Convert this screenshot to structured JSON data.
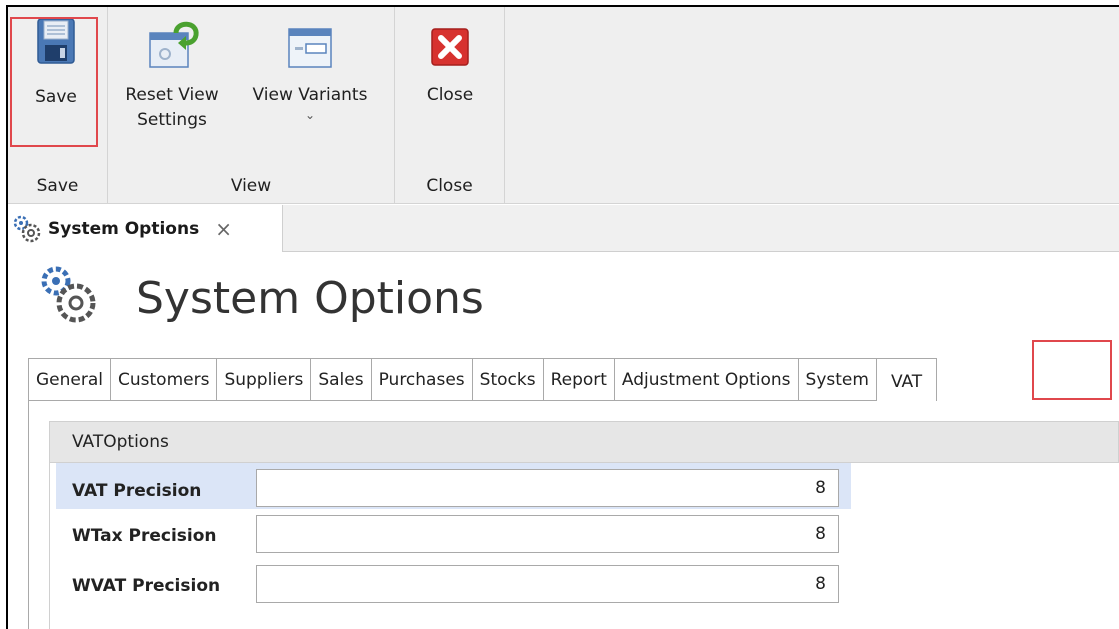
{
  "ribbon": {
    "groups": [
      {
        "label": "Save",
        "buttons": [
          {
            "label": "Save"
          }
        ]
      },
      {
        "label": "View",
        "buttons": [
          {
            "label": "Reset View Settings",
            "line1": "Reset View",
            "line2": "Settings"
          },
          {
            "label": "View Variants"
          }
        ]
      },
      {
        "label": "Close",
        "buttons": [
          {
            "label": "Close"
          }
        ]
      }
    ]
  },
  "document_tab": {
    "title": "System Options",
    "close_glyph": "×"
  },
  "page": {
    "title": "System Options"
  },
  "tabs": [
    "General",
    "Customers",
    "Suppliers",
    "Sales",
    "Purchases",
    "Stocks",
    "Report",
    "Adjustment Options",
    "System",
    "VAT"
  ],
  "active_tab": "VAT",
  "group": {
    "header": "VATOptions",
    "fields": [
      {
        "label": "VAT Precision",
        "value": "8"
      },
      {
        "label": "WTax Precision",
        "value": "8"
      },
      {
        "label": "WVAT Precision",
        "value": "8"
      }
    ]
  },
  "colors": {
    "highlight": "#e0474c",
    "focus_row": "#dbe5f7",
    "ribbon_bg": "#efefef"
  },
  "icons": [
    "floppy-disk-icon",
    "reset-view-icon",
    "view-variants-icon",
    "close-red-x-icon",
    "gears-icon"
  ]
}
